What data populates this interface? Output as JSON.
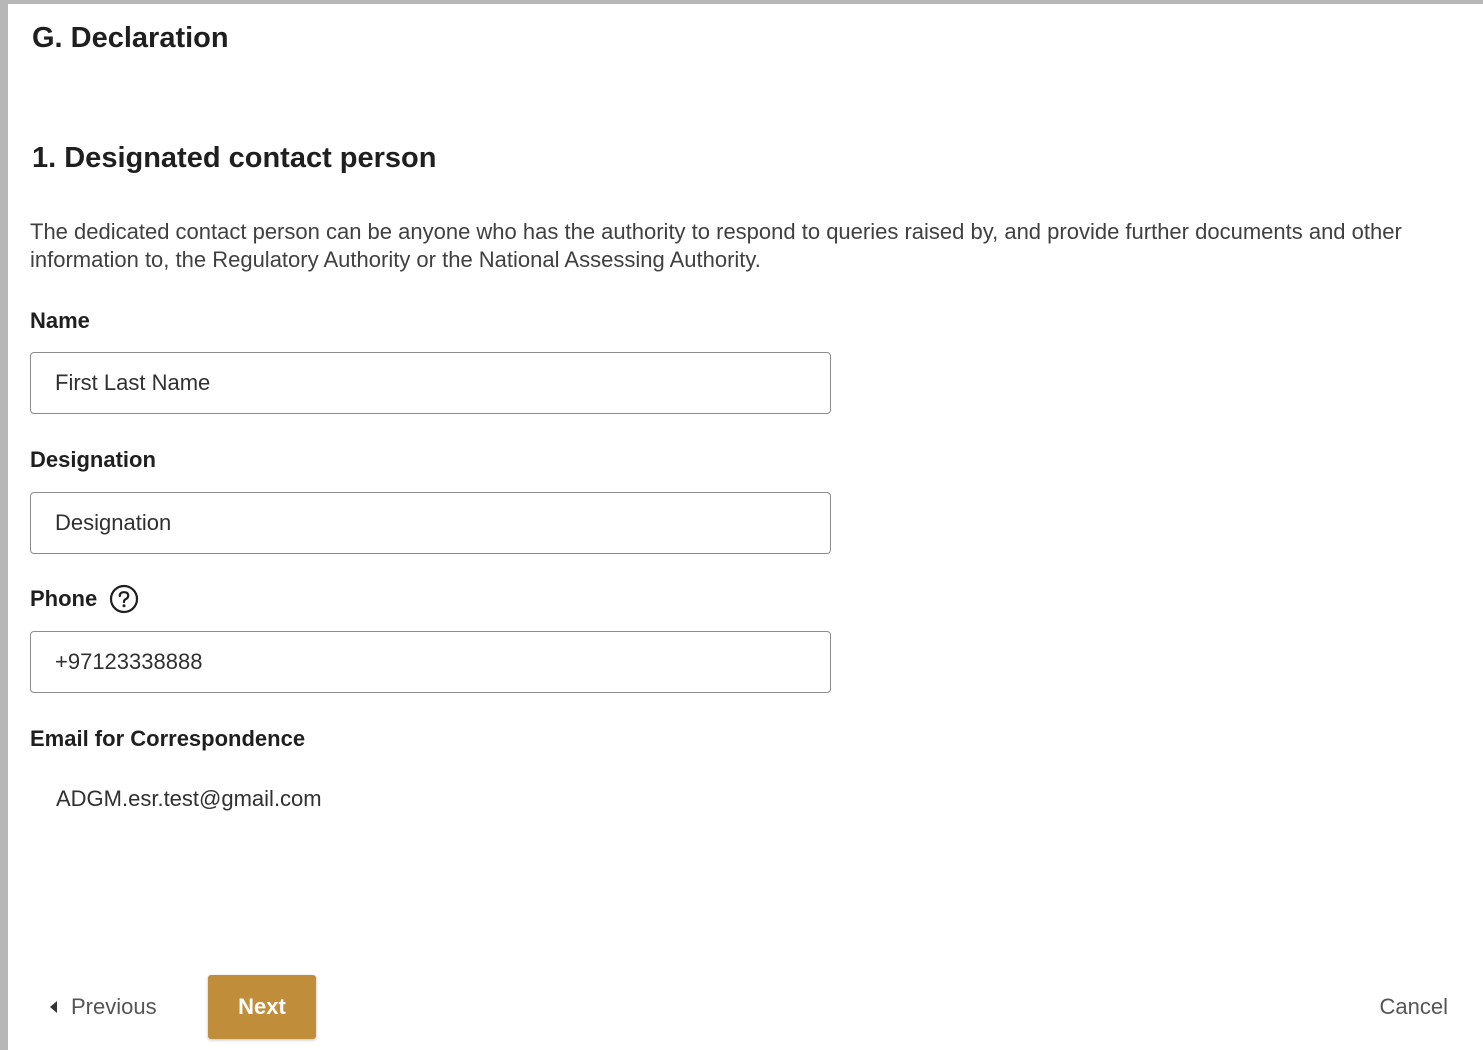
{
  "section": {
    "title": "G. Declaration"
  },
  "subsection": {
    "title": "1. Designated contact person",
    "description": "The dedicated contact person can be anyone who has the authority to respond to queries raised by, and provide further documents and other information to, the Regulatory Authority or the National Assessing Authority."
  },
  "fields": {
    "name": {
      "label": "Name",
      "value": "First Last Name"
    },
    "designation": {
      "label": "Designation",
      "value": "Designation"
    },
    "phone": {
      "label": "Phone",
      "value": "+97123338888",
      "help_icon": "question-circle-icon"
    },
    "email": {
      "label": "Email for Correspondence",
      "value": "ADGM.esr.test@gmail.com"
    }
  },
  "navigation": {
    "previous_label": "Previous",
    "next_label": "Next",
    "cancel_label": "Cancel"
  },
  "colors": {
    "accent": "#c08e3a",
    "border": "#b7b7b7"
  }
}
